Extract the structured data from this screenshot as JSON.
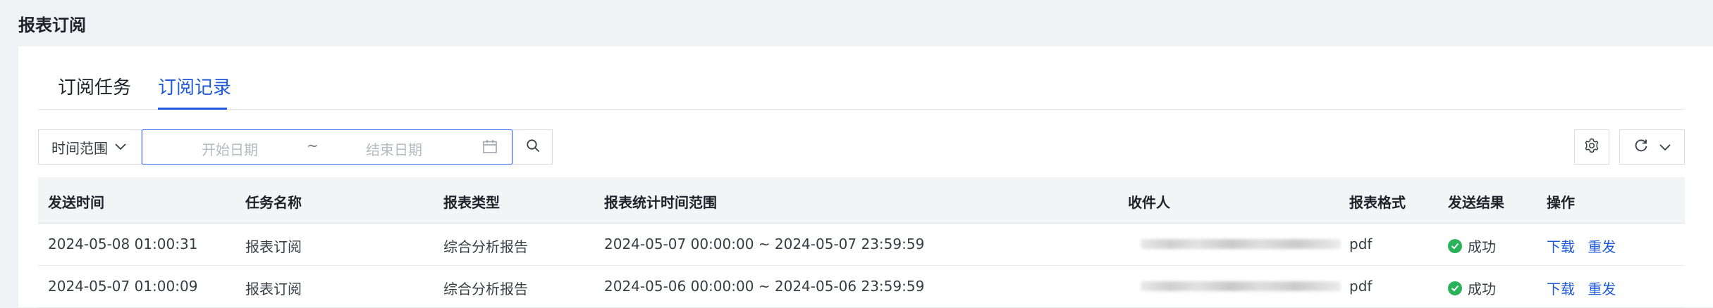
{
  "page": {
    "title": "报表订阅"
  },
  "tabs": [
    {
      "label": "订阅任务",
      "active": false
    },
    {
      "label": "订阅记录",
      "active": true
    }
  ],
  "filter": {
    "range_select": "时间范围",
    "start_placeholder": "开始日期",
    "separator": "~",
    "end_placeholder": "结束日期"
  },
  "colors": {
    "accent": "#1f5bd8",
    "success": "#29b25a",
    "header_bg": "#f3f4f6"
  },
  "table": {
    "columns": [
      "发送时间",
      "任务名称",
      "报表类型",
      "报表统计时间范围",
      "收件人",
      "报表格式",
      "发送结果",
      "操作"
    ],
    "rows": [
      {
        "send_time": "2024-05-08 01:00:31",
        "task_name": "报表订阅",
        "report_type": "综合分析报告",
        "stat_range": "2024-05-07 00:00:00 ~ 2024-05-07 23:59:59",
        "format": "pdf",
        "result": "成功",
        "action_download": "下载",
        "action_resend": "重发"
      },
      {
        "send_time": "2024-05-07 01:00:09",
        "task_name": "报表订阅",
        "report_type": "综合分析报告",
        "stat_range": "2024-05-06 00:00:00 ~ 2024-05-06 23:59:59",
        "format": "pdf",
        "result": "成功",
        "action_download": "下载",
        "action_resend": "重发"
      }
    ]
  }
}
